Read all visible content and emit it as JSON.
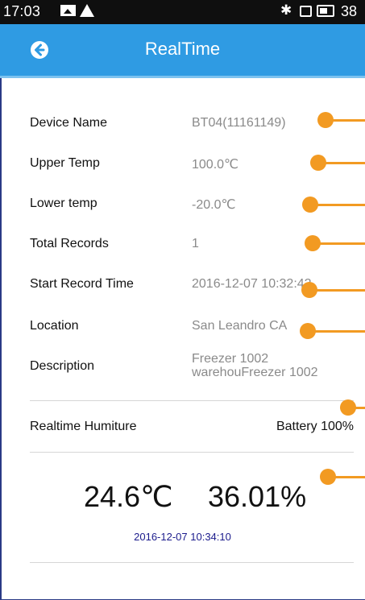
{
  "status_bar": {
    "time": "17:03",
    "battery_text": "38"
  },
  "app_bar": {
    "title": "RealTime"
  },
  "info": {
    "device_name_label": "Device Name",
    "device_name_value": "BT04(11161149)",
    "upper_temp_label": "Upper Temp",
    "upper_temp_value": "100.0℃",
    "lower_temp_label": "Lower temp",
    "lower_temp_value": "-20.0℃",
    "total_records_label": "Total Records",
    "total_records_value": "1",
    "start_time_label": "Start Record Time",
    "start_time_value": "2016-12-07 10:32:42",
    "location_label": "Location",
    "location_value": "San Leandro CA",
    "description_label": "Description",
    "description_line1": "Freezer 1002",
    "description_line2": "warehouFreezer 1002"
  },
  "realtime": {
    "label": "Realtime Humiture",
    "battery": "Battery 100%",
    "temperature": "24.6℃",
    "humidity": "36.01%",
    "timestamp": "2016-12-07 10:34:10"
  },
  "colors": {
    "app_bar": "#2f9be3",
    "annotation": "#f29a22",
    "timestamp": "#1b1b8c"
  }
}
